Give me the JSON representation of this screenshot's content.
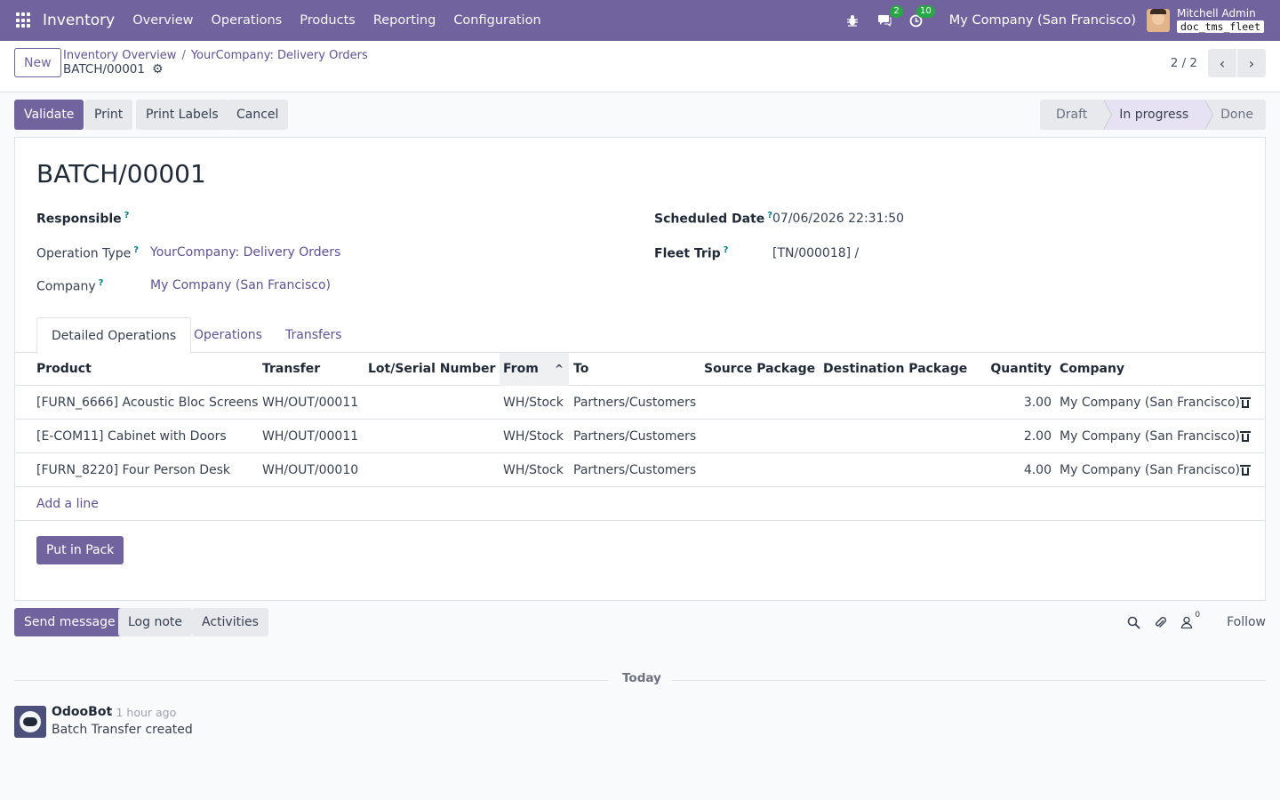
{
  "navbar": {
    "app_name": "Inventory",
    "menu": [
      "Overview",
      "Operations",
      "Products",
      "Reporting",
      "Configuration"
    ],
    "messages_count": "2",
    "activities_count": "10",
    "company": "My Company (San Francisco)",
    "user_name": "Mitchell Admin",
    "database": "doc_tms_fleet",
    "accent_color": "#71639e"
  },
  "control_panel": {
    "new_label": "New",
    "breadcrumb": [
      "Inventory Overview",
      "YourCompany: Delivery Orders"
    ],
    "record_name": "BATCH/00001",
    "pager": "2 / 2"
  },
  "statusbar": {
    "buttons": [
      "Validate",
      "Print",
      "Print Labels",
      "Cancel"
    ],
    "stages": [
      "Draft",
      "In progress",
      "Done"
    ],
    "active_stage": "In progress"
  },
  "form": {
    "title": "BATCH/00001",
    "responsible_label": "Responsible",
    "responsible_value": "",
    "operation_type_label": "Operation Type",
    "operation_type_value": "YourCompany: Delivery Orders",
    "company_label": "Company",
    "company_value": "My Company (San Francisco)",
    "scheduled_date_label": "Scheduled Date",
    "scheduled_date_value": "07/06/2026 22:31:50",
    "fleet_trip_label": "Fleet Trip",
    "fleet_trip_value": "[TN/000018] /",
    "help_mark": "?"
  },
  "tabs": [
    "Detailed Operations",
    "Operations",
    "Transfers"
  ],
  "table": {
    "headers": [
      "Product",
      "Transfer",
      "Lot/Serial Number",
      "From",
      "To",
      "Source Package",
      "Destination Package",
      "Quantity",
      "Company"
    ],
    "rows": [
      {
        "product": "[FURN_6666] Acoustic Bloc Screens",
        "transfer": "WH/OUT/00011",
        "lot": "",
        "from": "WH/Stock",
        "to": "Partners/Customers",
        "src_pkg": "",
        "dst_pkg": "",
        "qty": "3.00",
        "company": "My Company (San Francisco)"
      },
      {
        "product": "[E-COM11] Cabinet with Doors",
        "transfer": "WH/OUT/00011",
        "lot": "",
        "from": "WH/Stock",
        "to": "Partners/Customers",
        "src_pkg": "",
        "dst_pkg": "",
        "qty": "2.00",
        "company": "My Company (San Francisco)"
      },
      {
        "product": "[FURN_8220] Four Person Desk",
        "transfer": "WH/OUT/00010",
        "lot": "",
        "from": "WH/Stock",
        "to": "Partners/Customers",
        "src_pkg": "",
        "dst_pkg": "",
        "qty": "4.00",
        "company": "My Company (San Francisco)"
      }
    ],
    "add_line": "Add a line",
    "put_in_pack": "Put in Pack"
  },
  "chatter": {
    "send_message": "Send message",
    "log_note": "Log note",
    "activities": "Activities",
    "followers_count": "0",
    "follow": "Follow",
    "date_divider": "Today",
    "messages": [
      {
        "author": "OdooBot",
        "time": "- 1 hour ago",
        "body": "Batch Transfer created"
      }
    ]
  }
}
